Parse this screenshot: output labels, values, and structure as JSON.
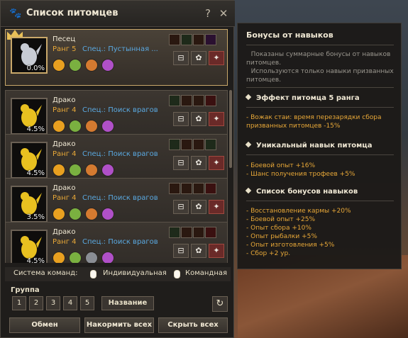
{
  "window": {
    "title": "Список питомцев",
    "help_label": "?",
    "close_label": "✕"
  },
  "pets": [
    {
      "name": "Песец",
      "rank": "Ранг 5",
      "spec": "Спец.: Пустынная ...",
      "percent": "0.0%",
      "selected": true,
      "skills": [
        "y",
        "g",
        "o",
        "p"
      ],
      "tags": [
        "#2a1810",
        "#1e2a1a",
        "#2a1810",
        "#2a1030"
      ]
    },
    {
      "name": "Драко",
      "rank": "Ранг 4",
      "spec": "Спец.: Поиск врагов",
      "percent": "4.5%",
      "selected": false,
      "skills": [
        "y",
        "g",
        "o",
        "p"
      ],
      "tags": [
        "#1e2a1a",
        "#2a1810",
        "#2a1810",
        "#3a1010"
      ]
    },
    {
      "name": "Драко",
      "rank": "Ранг 4",
      "spec": "Спец.: Поиск врагов",
      "percent": "4.5%",
      "selected": false,
      "skills": [
        "y",
        "g",
        "o",
        "p"
      ],
      "tags": [
        "#1e2a1a",
        "#2a1810",
        "#2a1810",
        "#1e2a1a"
      ]
    },
    {
      "name": "Драко",
      "rank": "Ранг 4",
      "spec": "Спец.: Поиск врагов",
      "percent": "3.5%",
      "selected": false,
      "skills": [
        "y",
        "g",
        "o",
        "p"
      ],
      "tags": [
        "#2a1810",
        "#2a1810",
        "#2a1810",
        "#3a1010"
      ]
    },
    {
      "name": "Драко",
      "rank": "Ранг 4",
      "spec": "Спец.: Поиск врагов",
      "percent": "4.5%",
      "selected": false,
      "skills": [
        "y",
        "g",
        "w",
        "p"
      ],
      "tags": [
        "#1e2a1a",
        "#2a1810",
        "#2a1810",
        "#3a1010"
      ]
    }
  ],
  "command": {
    "label": "Система команд:",
    "individual": "Индивидуальная",
    "team": "Командная"
  },
  "group": {
    "label": "Группа",
    "slots": [
      "1",
      "2",
      "3",
      "4",
      "5"
    ],
    "name_button": "Название",
    "refresh_icon": "↻"
  },
  "footer": {
    "swap": "Обмен",
    "feed_all": "Накормить всех",
    "hide_all": "Скрыть всех"
  },
  "tooltip": {
    "title": "Бонусы от навыков",
    "notes": [
      "⠀Показаны суммарные бонусы от навыков питомцев.",
      "⠀Используются только навыки призванных питомцев."
    ],
    "sections": [
      {
        "heading": "Эффект питомца 5 ранга",
        "lines": [
          "- Вожак стаи: время перезарядки сбора призванных питомцев -15%"
        ]
      },
      {
        "heading": "Уникальный навык питомца",
        "lines": [
          "- Боевой опыт +16%",
          "- Шанс получения трофеев +5%"
        ]
      },
      {
        "heading": "Список бонусов навыков",
        "lines": [
          "- Восстановление кармы +20%",
          "- Боевой опыт +25%",
          "- Опыт сбора +10%",
          "- Опыт рыбалки +5%",
          "- Опыт изготовления +5%",
          "- Сбор +2 ур."
        ]
      }
    ]
  },
  "colors": {
    "rank": "#e8a838",
    "spec": "#5aa8e0",
    "bonus": "#e8a838",
    "selected_border": "#c9a86a"
  }
}
